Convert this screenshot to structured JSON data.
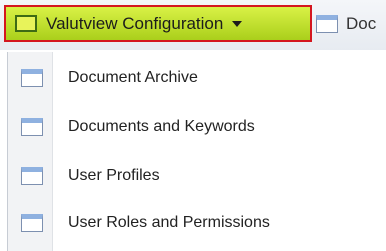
{
  "toolbar": {
    "active_menu": {
      "label": "Valutview Configuration",
      "icon": "window-icon",
      "caret_icon": "caret-down-icon",
      "highlight_color": "#c8e630",
      "border_color": "#d4161f"
    },
    "next_tab": {
      "label": "Doc",
      "icon": "window-icon"
    }
  },
  "dropdown": {
    "items": [
      {
        "label": "Document Archive",
        "icon": "window-icon"
      },
      {
        "label": "Documents and Keywords",
        "icon": "window-icon"
      },
      {
        "label": "User Profiles",
        "icon": "window-icon"
      },
      {
        "label": "User Roles and Permissions",
        "icon": "window-icon"
      }
    ]
  }
}
